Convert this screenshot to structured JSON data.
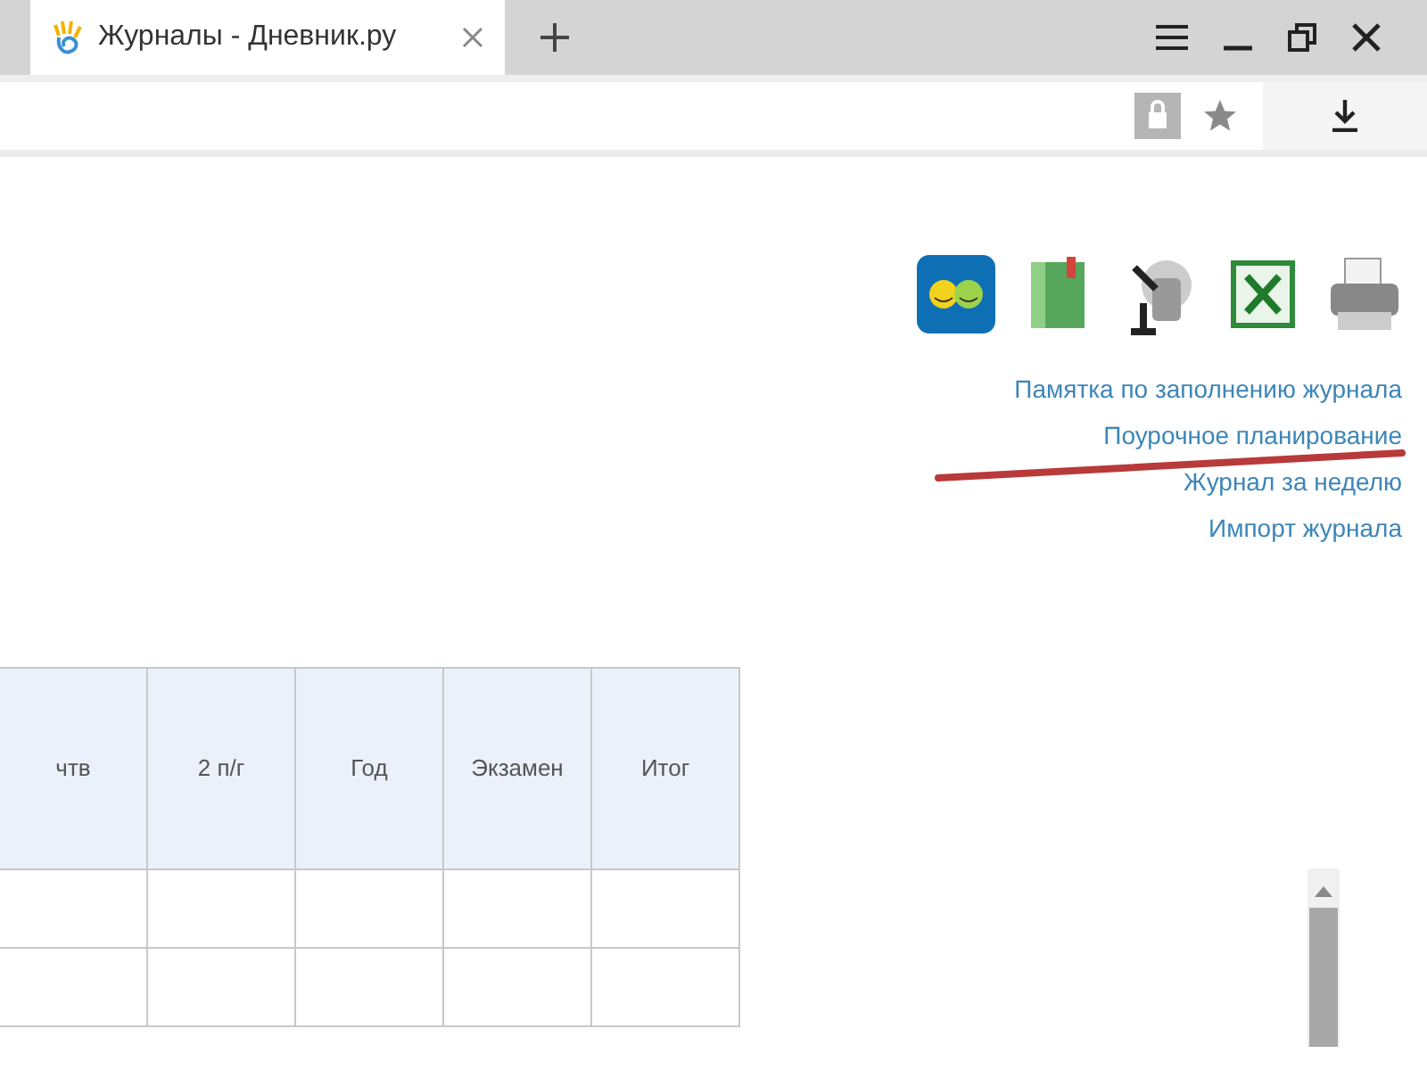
{
  "browser": {
    "tab": {
      "title": "Журналы - Дневник.ру",
      "selected": true
    }
  },
  "toolbar_links": [
    "Памятка по заполнению журнала",
    "Поурочное планирование",
    "Журнал за неделю",
    "Импорт журнала"
  ],
  "table": {
    "columns": [
      "чтв",
      "2 п/г",
      "Год",
      "Экзамен",
      "Итог"
    ]
  }
}
